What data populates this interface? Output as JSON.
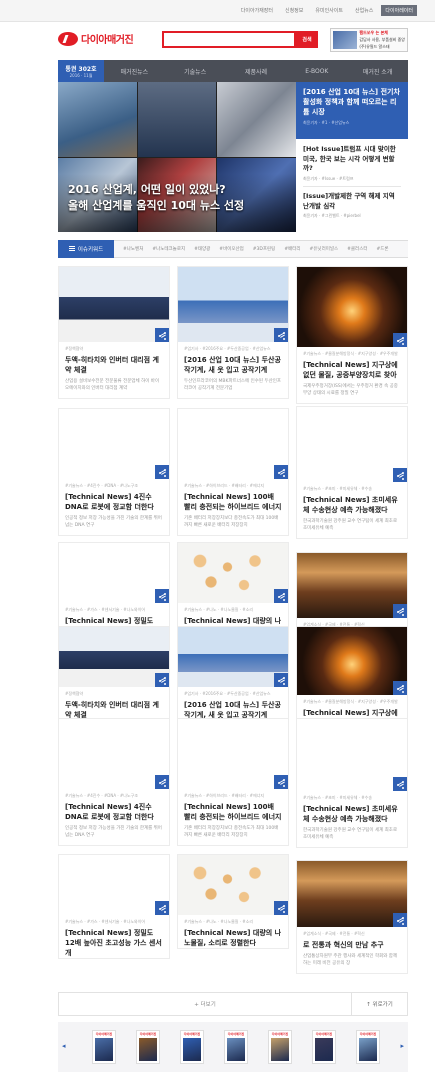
{
  "topbar": {
    "links": [
      "다이아가재장터",
      "신청정보",
      "유미인사이트",
      "산업뉴스",
      "다이아레이터"
    ],
    "active_index": 4
  },
  "header": {
    "logo_text": "다이아매거진",
    "search_placeholder": "",
    "search_button": "검색",
    "banner": {
      "line1": "팸드쏘우 는 본체",
      "line2": "갑담사 사용, 부품설비 중앙",
      "line3": "(주)유필드 알스태"
    }
  },
  "nav": {
    "issue_label": "통권 302호",
    "issue_date": "2016 · 11월",
    "items": [
      "매거진뉴스",
      "기술뉴스",
      "제품사례",
      "E-BOOK",
      "매거진 소개"
    ]
  },
  "hero": {
    "overlay_line1": "2016 산업계, 어떤 일이 있었나?",
    "overlay_line2": "올해 산업계를 움직인 10대 뉴스 선정",
    "featured": {
      "title": "[2016 산업 10대 뉴스] 전기차 활성화 정책과 함께 떠오르는 리튬 시장",
      "meta": "최윤기자 · #1 · #산업뉴스"
    },
    "side": [
      {
        "title": "[Hot Issue]트럼프 시대 맞이한 미국, 한국 보는 시각 어떻게 변할까?",
        "meta": "최윤기자 · #Issue · #트럼프"
      },
      {
        "title": "[Issue]개발제한 구역 해제 지역 난개발 심각",
        "meta": "최윤기자 · #그린벨트 · #pierbel"
      }
    ]
  },
  "keywords": {
    "button": "이슈키워드",
    "tags": [
      "#나노벤처",
      "#나노테크놀로지",
      "#태양광",
      "#바이오산업",
      "#3D프린팅",
      "#배터리",
      "#유닛러미널스",
      "#클러스터",
      "#드론"
    ]
  },
  "cards": [
    {
      "image": "person",
      "meta": "#정책협약",
      "title": "두액-히타치와 인버터 대리점 계약 체결",
      "summary": "산업용 설비보수전문 전문물류 전문업체 하이 바이오에이치와의 인버터 대리점 계약"
    },
    {
      "image": "event",
      "meta": "#업기사 · #2016주요 · #두산중공업 · #산업뉴스",
      "title": "[2016 산업 10대 뉴스] 두산공작기계, 새 옷 입고 공작기계",
      "summary": "두산인프라코어의 MBK파트너스에 인수된 두산인프라코어 공작기계 전문기업"
    },
    {
      "image": "lab",
      "meta": "#기술뉴스 · #물질분해방정식 · #지구양성 · #우주개발",
      "title": "[Technical News] 지구상에 없던 물질, 공중부양장치로 찾아",
      "summary": "국제우주정거장(ISS)에서는 우주정거 환경 속 공중부양 상태의 시료를 정밀 연구"
    },
    {
      "image": "dna",
      "meta": "#기술뉴스 · #4진수 · #DNA · #나노구조",
      "title": "[Technical News] 4진수 DNA로 로봇에 정교함 더한다",
      "summary": "인공적 정보 저장 가능성을 가진 기술의 한계를 뛰어넘는 DNA 연구"
    },
    {
      "image": "batt",
      "meta": "#기술뉴스 · #하이브리드 · #배터리 · #에너지",
      "title": "[Technical News] 100배 빨리 충전되는 하이브리드 에너지",
      "summary": "기존 배터리 저장장치보다 충전속도가 최대 100배까지 빠른 새로운 배터리 저장장치"
    },
    {
      "image": "diag",
      "meta": "#기술뉴스 · #초미 · #미세유체 · #수송",
      "title": "[Technical News] 초미세유체 수송현상 예측 가능해졌다",
      "summary": "한국과학기술원 강주원 교수 연구팀이 세계 최초로 초미세유체 예측"
    },
    {
      "image": "sensor",
      "meta": "#기술뉴스 · #가스 · #센서기술 · #나노와이어",
      "title": "[Technical News] 정밀도 12배 높아진 초고성능 가스 센서 개",
      "summary": ""
    },
    {
      "image": "nano",
      "meta": "#기술뉴스 · #나노 · #나노물질 · #소리",
      "title": "[Technical News] 대량의 나노물질, 소리로 정렬한다",
      "summary": ""
    },
    {
      "image": "hall",
      "meta": "#업계소식 · #국제 · #전통 · #혁신",
      "title": "로 전통과 혁신의 만남 추구",
      "summary": "산업통상자원부 주관 행사와 세계적인 학회와 함께하는 미래 비전 공유의 장"
    }
  ],
  "more": {
    "load_more": "+ 더보기",
    "top": "↑ 위로가기"
  },
  "strip": {
    "mag_label": "다이아매거진",
    "count": 7
  }
}
